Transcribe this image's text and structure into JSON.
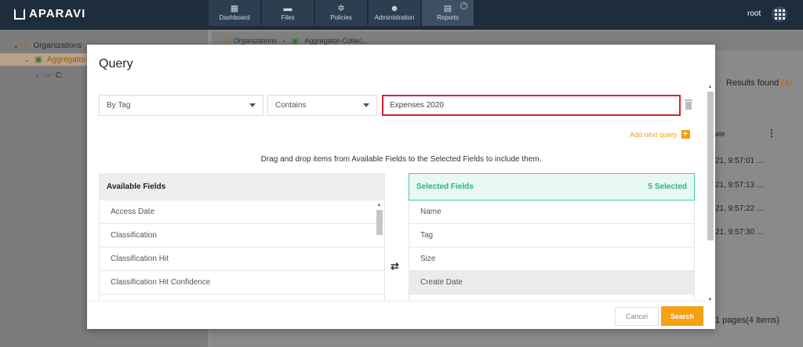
{
  "app": {
    "logo": "APARAVI",
    "nav": [
      {
        "label": "Dashboard",
        "icon": "dashboard-icon"
      },
      {
        "label": "Files",
        "icon": "folder-icon"
      },
      {
        "label": "Policies",
        "icon": "gear-icon"
      },
      {
        "label": "Administration",
        "icon": "users-icon"
      },
      {
        "label": "Reports",
        "icon": "clipboard-icon"
      }
    ],
    "help": "?",
    "user": "root"
  },
  "sidebar": {
    "items": [
      {
        "label": "Organizations"
      },
      {
        "label": "Aggregator-C"
      },
      {
        "label": "C:"
      }
    ]
  },
  "breadcrumb": {
    "items": [
      "Organizations",
      "Aggregator-Collec..."
    ]
  },
  "results": {
    "label": "Results found",
    "count": "(4)",
    "column": "ate",
    "rows": [
      "21, 9:57:01 ...",
      "21, 9:57:13 ...",
      "21, 9:57:22 ...",
      "21, 9:57:30 ..."
    ],
    "pagination": "1 pages(4 items)"
  },
  "dialog": {
    "title": "Query",
    "field_select": "By Tag",
    "operator_select": "Contains",
    "query_value": "Expenses 2020",
    "add_next": "Add next query",
    "instructions": "Drag and drop items from Available Fields to the Selected Fields to include them.",
    "available": {
      "header": "Available Fields",
      "items": [
        "Access Date",
        "Classification",
        "Classification Hit",
        "Classification Hit Confidence",
        ""
      ]
    },
    "selected": {
      "header": "Selected Fields",
      "count_label": "5 Selected",
      "items": [
        "Name",
        "Tag",
        "Size",
        "Create Date",
        ""
      ]
    },
    "cancel": "Cancel",
    "search": "Search"
  },
  "colors": {
    "accent": "#f5a112",
    "highlight_border": "#d6202e",
    "selected_green": "#2bb57f",
    "topbar": "#1e2d3b"
  }
}
